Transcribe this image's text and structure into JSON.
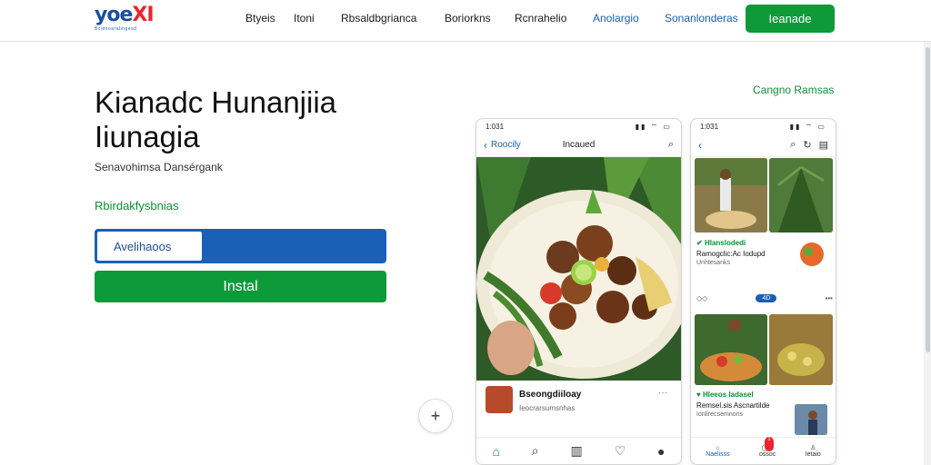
{
  "header": {
    "logo_main": "yoe",
    "logo_accent": "XI",
    "logo_tagline": "Bcidnoaralingesd",
    "nav": [
      "Btyeis",
      "Itoni",
      "Rbsaldbgrianca",
      "Boriorkns",
      "Rcnrahelio",
      "Anolargio",
      "Sonanlonderas"
    ],
    "nav_blue": [
      false,
      false,
      false,
      false,
      false,
      true,
      true
    ],
    "cta_label": "Ieanade"
  },
  "hero": {
    "title": "Kianadc Hunanjiia Iiunagia",
    "subtitle": "Senavohimsa Dansérgank",
    "link": "Rbirdakfysbnias",
    "input_label": "Avelihaoos",
    "install_label": "Instal",
    "right_link": "Cangno Ramsas",
    "fab_symbol": "+"
  },
  "phone1": {
    "time": "1:031",
    "back_label": "Roocily",
    "title": "Incaued",
    "post_title": "Bseongdiiloay",
    "post_meta": "Ieocrarsumsnhas",
    "more": "···",
    "tabs": [
      "home-icon",
      "search-icon",
      "library-icon",
      "heart-icon",
      "profile-icon"
    ]
  },
  "phone2": {
    "time": "1:031",
    "card1_badge": "Hlanslodedi",
    "card1_title": "Ramogclic:Ac Iodupd",
    "card1_meta": "Unhtesanks",
    "action_count": "4D",
    "card2_badge": "Hleeos ladasel",
    "card2_title": "Remsel.sis Ascnartilde",
    "card2_meta": "Ionlirecsemnons",
    "tab1": "Naelisss",
    "tab2": "ossoc",
    "tab3": "Ietaio",
    "badge": "1"
  },
  "colors": {
    "brand_blue": "#1a5fb8",
    "brand_green": "#0f9a3a",
    "logo_red": "#e8262c"
  }
}
